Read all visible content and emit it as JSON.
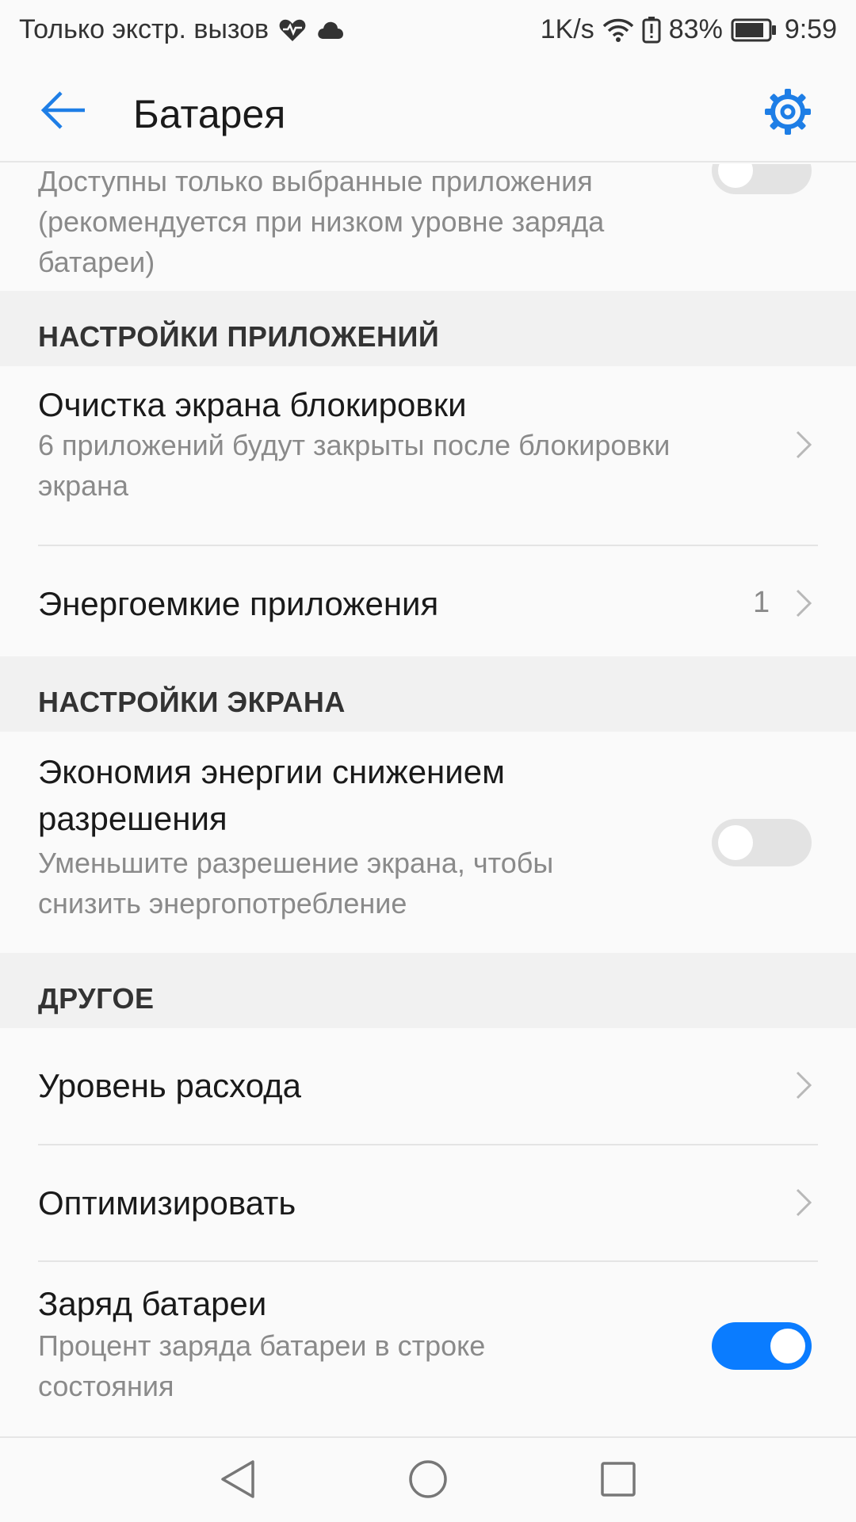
{
  "status_bar": {
    "carrier_text": "Только экстр. вызов",
    "speed": "1K/s",
    "battery_percent": "83%",
    "time": "9:59",
    "icons": [
      "heart-pulse-icon",
      "cloud-icon",
      "wifi-icon",
      "battery-alert-icon",
      "battery-icon"
    ]
  },
  "app_bar": {
    "title": "Батарея",
    "back_icon": "arrow-left-icon",
    "settings_icon": "gear-icon"
  },
  "rows": {
    "partial_item": {
      "subtitle_line1": "Доступны только выбранные приложения",
      "subtitle_line2": "(рекомендуется при низком уровне заряда",
      "subtitle_line3": "батареи)",
      "toggle_on": false
    },
    "section_apps": "НАСТРОЙКИ ПРИЛОЖЕНИЙ",
    "lock_cleanup": {
      "title": "Очистка экрана блокировки",
      "subtitle_line1": "6 приложений будут закрыты после блокировки",
      "subtitle_line2": "экрана"
    },
    "power_intensive": {
      "title": "Энергоемкие приложения",
      "count": "1"
    },
    "section_screen": "НАСТРОЙКИ ЭКРАНА",
    "resolution_saving": {
      "title_line1": "Экономия энергии снижением",
      "title_line2": "разрешения",
      "subtitle_line1": "Уменьшите разрешение экрана, чтобы",
      "subtitle_line2": "снизить энергопотребление",
      "toggle_on": false
    },
    "section_other": "ДРУГОЕ",
    "consumption_level": {
      "title": "Уровень расхода"
    },
    "optimize": {
      "title": "Оптимизировать"
    },
    "battery_percent": {
      "title": "Заряд батареи",
      "subtitle_line1": "Процент заряда батареи в строке",
      "subtitle_line2": "состояния",
      "toggle_on": true
    }
  },
  "nav_bar": {
    "icons": [
      "back-triangle-icon",
      "home-circle-icon",
      "recents-square-icon"
    ]
  },
  "colors": {
    "accent": "#0a7cff",
    "background": "#fafafa",
    "section_bg": "#f1f1f1",
    "secondary_text": "#8a8a8a"
  }
}
